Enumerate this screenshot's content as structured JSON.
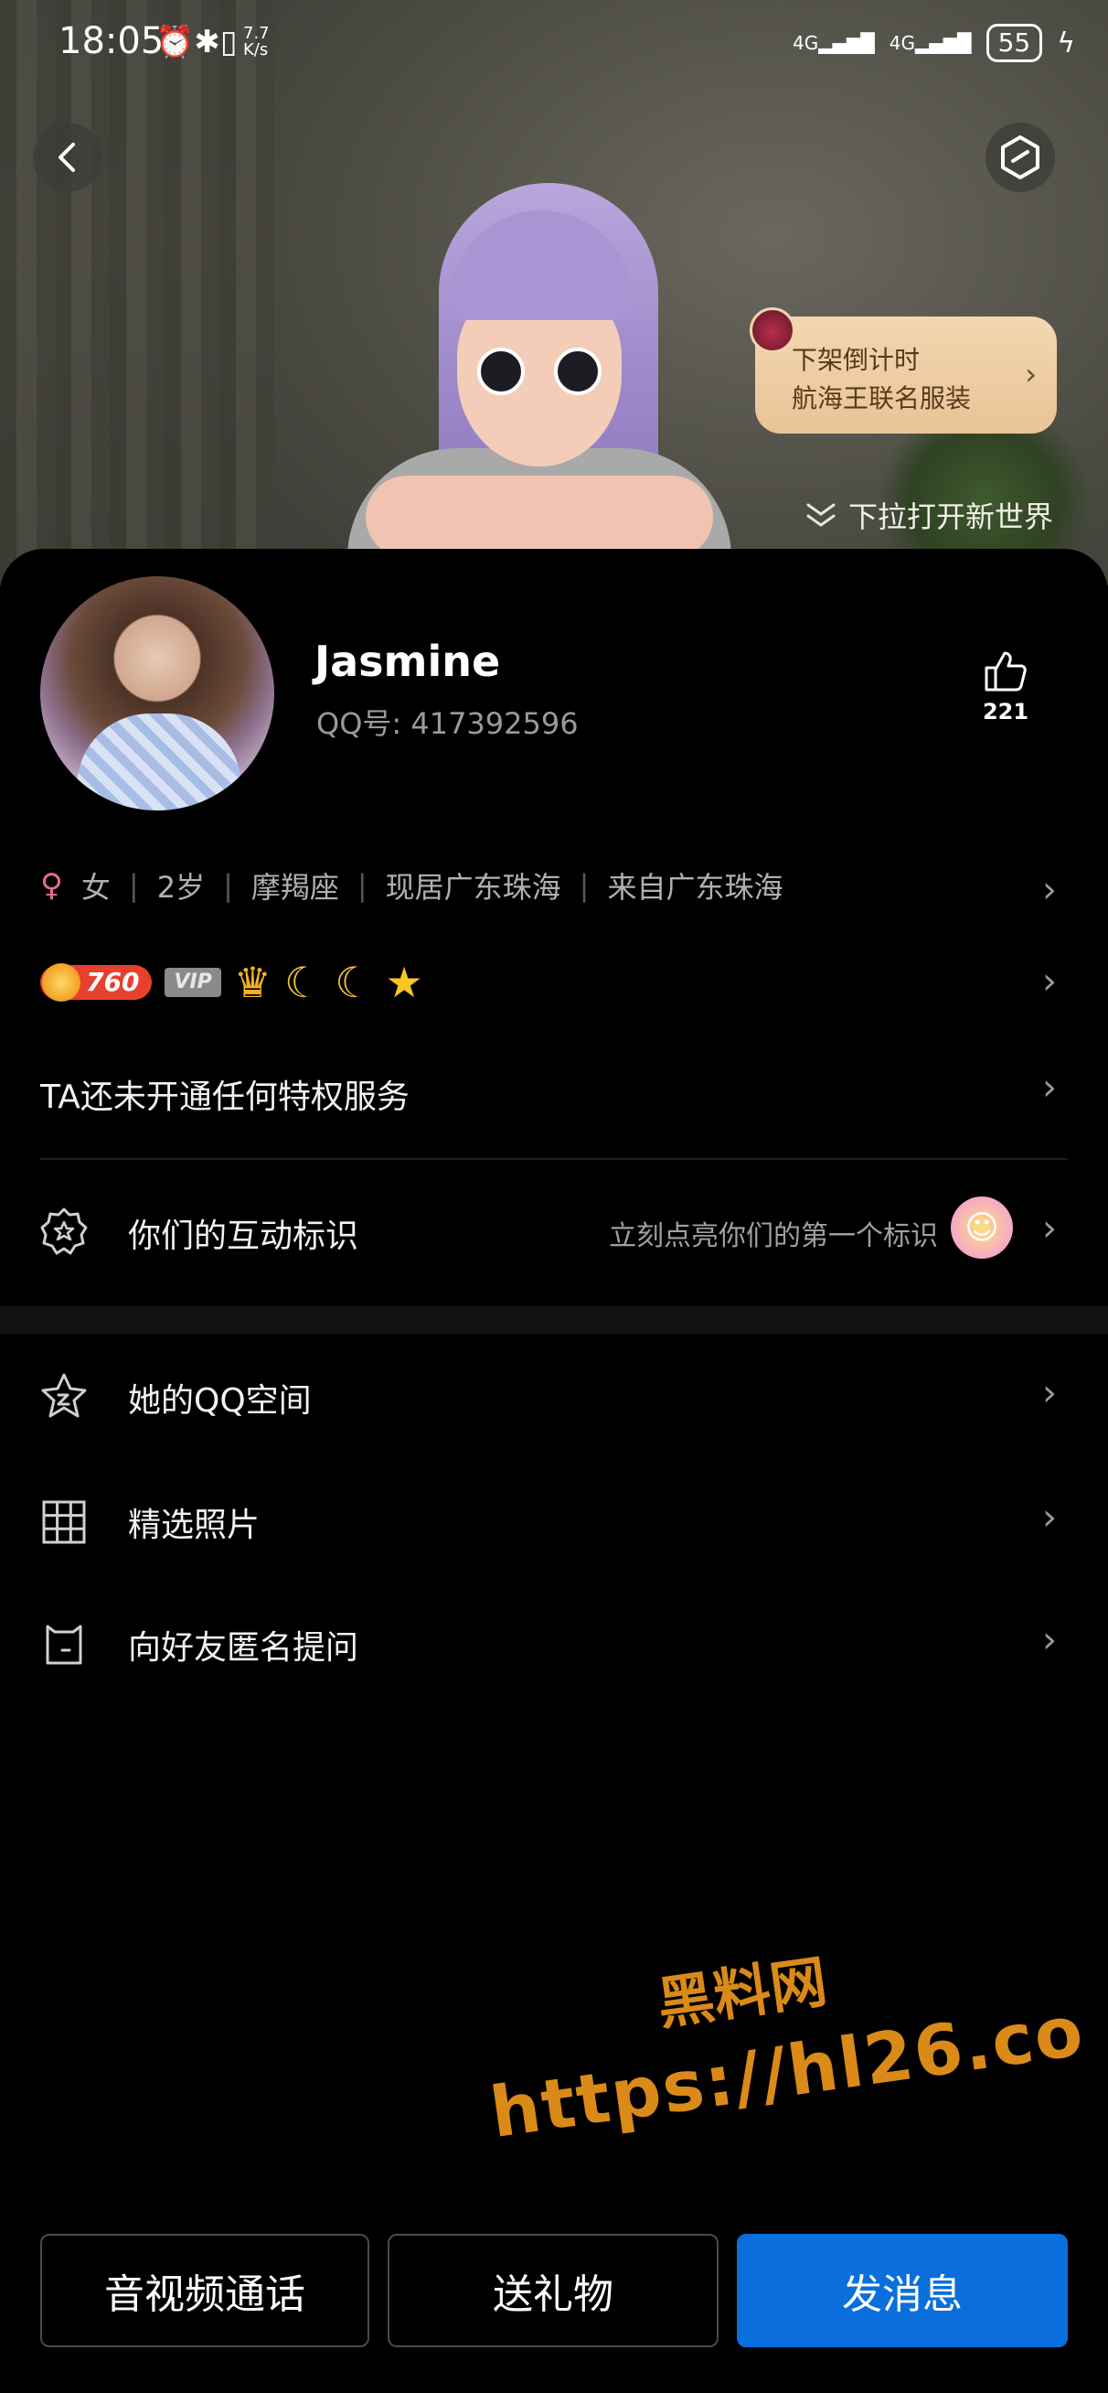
{
  "status_bar": {
    "time": "18:05",
    "speed_top": "7.7",
    "speed_bottom": "K/s",
    "network1": "4G",
    "network2": "4G",
    "battery": "55"
  },
  "header": {
    "promo_line1": "下架倒计时",
    "promo_line2": "航海王联名服装",
    "pull_hint": "下拉打开新世界"
  },
  "profile": {
    "name": "Jasmine",
    "qq_label": "QQ号:",
    "qq_number": "417392596",
    "likes": "221",
    "gender": "女",
    "age": "2岁",
    "zodiac": "摩羯座",
    "lives_in": "现居广东珠海",
    "from": "来自广东珠海",
    "coin_level": "760",
    "vip_label": "VIP"
  },
  "rows": {
    "privilege": "TA还未开通任何特权服务",
    "interaction_label": "你们的互动标识",
    "interaction_hint": "立刻点亮你们的第一个标识"
  },
  "list": [
    {
      "label": "她的QQ空间",
      "icon": "qzone-star-icon"
    },
    {
      "label": "精选照片",
      "icon": "photo-grid-icon"
    },
    {
      "label": "向好友匿名提问",
      "icon": "anonymous-question-icon"
    }
  ],
  "watermark": {
    "line1": "黑料网",
    "line2": "https://hl26.co"
  },
  "actions": {
    "call": "音视频通话",
    "gift": "送礼物",
    "message": "发消息"
  },
  "colors": {
    "primary": "#0a6fdc",
    "background": "#000000",
    "watermark": "#d98a18"
  }
}
